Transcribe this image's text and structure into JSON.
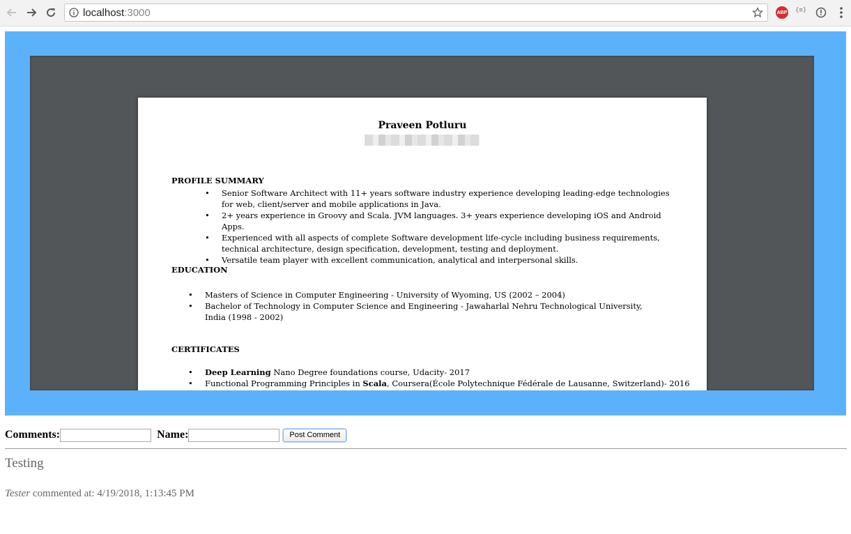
{
  "browser": {
    "url_host": "localhost",
    "url_port": ":3000"
  },
  "resume": {
    "name": "Praveen Potluru",
    "profile_summary": {
      "title": "PROFILE SUMMARY",
      "items": [
        "Senior Software Architect with 11+ years software industry experience developing leading-edge technologies for web, client/server and mobile applications in Java.",
        "2+ years experience in Groovy and Scala. JVM languages. 3+ years experience developing iOS and Android Apps.",
        "Experienced with all aspects of complete Software development life-cycle including business requirements, technical architecture, design specification, development, testing and deployment.",
        "Versatile team player with excellent communication, analytical and interpersonal skills."
      ]
    },
    "education": {
      "title": "EDUCATION",
      "items": [
        "Masters of Science in Computer Engineering - University of Wyoming, US (2002 – 2004)",
        "Bachelor of Technology in Computer Science and Engineering - Jawaharlal Nehru Technological University, India (1998 - 2002)"
      ]
    },
    "certificates": {
      "title": "CERTIFICATES",
      "item1_bold": "Deep Learning",
      "item1_rest": " Nano Degree foundations course, Udacity- 2017",
      "item2_pre": "Functional Programming Principles in ",
      "item2_bold": "Scala",
      "item2_rest": ", Coursera(École Polytechnique Fédérale de Lausanne, Switzerland)- 2016"
    }
  },
  "form": {
    "comments_label": "Comments:",
    "comments_value": "",
    "name_label": "Name:",
    "name_value": "",
    "submit_label": "Post Comment"
  },
  "comments": [
    {
      "text": "Testing",
      "author": "Tester",
      "meta": " commented at: 4/19/2018, 1:13:45 PM"
    }
  ]
}
